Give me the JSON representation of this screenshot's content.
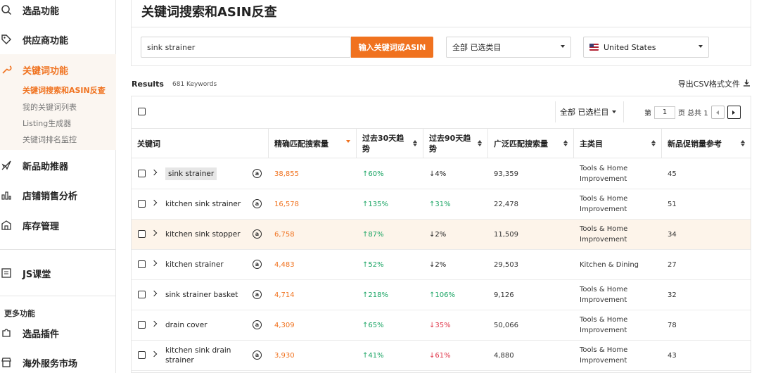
{
  "sidebar": {
    "items": [
      {
        "label": "选品功能",
        "icon": "search-icon"
      },
      {
        "label": "供应商功能",
        "icon": "tag-icon"
      },
      {
        "label": "关键词功能",
        "icon": "wrench-icon"
      },
      {
        "label": "新品助推器",
        "icon": "rocket-icon"
      },
      {
        "label": "店铺销售分析",
        "icon": "bar-chart-icon"
      },
      {
        "label": "库存管理",
        "icon": "warehouse-icon"
      },
      {
        "label": "JS课堂",
        "icon": "book-icon"
      },
      {
        "label": "选品插件",
        "icon": "puzzle-icon"
      },
      {
        "label": "海外服务市场",
        "icon": "store-icon"
      }
    ],
    "sub_items": [
      {
        "label": "关键词搜索和ASIN反查"
      },
      {
        "label": "我的关键词列表"
      },
      {
        "label": "Listing生成器"
      },
      {
        "label": "关键词排名监控"
      }
    ],
    "more_label": "更多功能"
  },
  "page_title": "关键词搜索和ASIN反查",
  "search": {
    "value": "sink strainer",
    "button_label": "输入关键词或ASIN",
    "category_select": "全部 已选类目",
    "country_select": "United States"
  },
  "results": {
    "label": "Results",
    "count": "681 Keywords",
    "export_label": "导出CSV格式文件"
  },
  "toolbar": {
    "column_select": "全部 已选栏目",
    "page_prefix": "第",
    "page_value": "1",
    "page_suffix": "页 总共 1"
  },
  "columns": [
    "关键词",
    "精确匹配搜索量",
    "过去30天趋势",
    "过去90天趋势",
    "广泛匹配搜索量",
    "主类目",
    "新品促销量参考"
  ],
  "rows": [
    {
      "keyword": "sink strainer",
      "exact": "38,855",
      "t30": "60%",
      "t30_dir": "up",
      "t90": "4%",
      "t90_dir": "down-dark",
      "broad": "93,359",
      "category": "Tools & Home Improvement",
      "sales": "45"
    },
    {
      "keyword": "kitchen sink strainer",
      "exact": "16,578",
      "t30": "135%",
      "t30_dir": "up",
      "t90": "31%",
      "t90_dir": "up",
      "broad": "22,478",
      "category": "Tools & Home Improvement",
      "sales": "51"
    },
    {
      "keyword": "kitchen sink stopper",
      "exact": "6,758",
      "t30": "87%",
      "t30_dir": "up",
      "t90": "2%",
      "t90_dir": "down-dark",
      "broad": "11,509",
      "category": "Tools & Home Improvement",
      "sales": "34"
    },
    {
      "keyword": "kitchen strainer",
      "exact": "4,483",
      "t30": "52%",
      "t30_dir": "up",
      "t90": "2%",
      "t90_dir": "down-dark",
      "broad": "29,503",
      "category": "Kitchen & Dining",
      "sales": "27"
    },
    {
      "keyword": "sink strainer basket",
      "exact": "4,714",
      "t30": "218%",
      "t30_dir": "up",
      "t90": "106%",
      "t90_dir": "up",
      "broad": "9,126",
      "category": "Tools & Home Improvement",
      "sales": "32"
    },
    {
      "keyword": "drain cover",
      "exact": "4,309",
      "t30": "65%",
      "t30_dir": "up",
      "t90": "35%",
      "t90_dir": "down-red",
      "broad": "50,066",
      "category": "Tools & Home Improvement",
      "sales": "78"
    },
    {
      "keyword": "kitchen sink drain strainer",
      "exact": "3,930",
      "t30": "41%",
      "t30_dir": "up",
      "t90": "61%",
      "t90_dir": "down-red",
      "broad": "4,880",
      "category": "Tools & Home Improvement",
      "sales": "43"
    }
  ],
  "colors": {
    "accent": "#f0721f",
    "up": "#19a463",
    "down_red": "#e0374a"
  }
}
